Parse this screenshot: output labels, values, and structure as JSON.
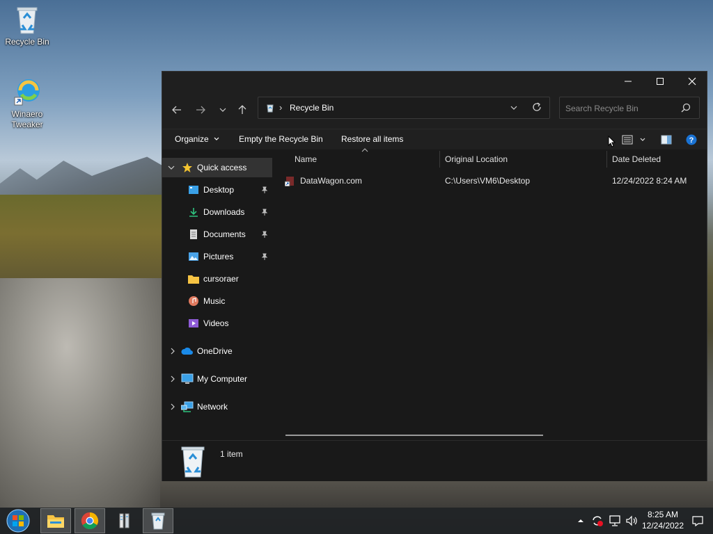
{
  "desktop": {
    "icons": [
      {
        "label": "Recycle Bin"
      },
      {
        "label": "Winaero\nTweaker",
        "line1": "Winaero",
        "line2": "Tweaker"
      }
    ]
  },
  "window": {
    "title": "Recycle Bin",
    "caption": {
      "minimize": "—",
      "maximize": "☐",
      "close": "✕"
    },
    "address": {
      "separator": "›",
      "location": "Recycle Bin"
    },
    "search": {
      "placeholder": "Search Recycle Bin"
    },
    "commands": {
      "organize": "Organize",
      "empty": "Empty the Recycle Bin",
      "restore": "Restore all items"
    },
    "nav": {
      "quick_access": "Quick access",
      "items": [
        {
          "label": "Desktop",
          "pinned": true,
          "icon": "desktop-icon"
        },
        {
          "label": "Downloads",
          "pinned": true,
          "icon": "download-icon"
        },
        {
          "label": "Documents",
          "pinned": true,
          "icon": "documents-icon"
        },
        {
          "label": "Pictures",
          "pinned": true,
          "icon": "pictures-icon"
        },
        {
          "label": "cursoraer",
          "pinned": false,
          "icon": "folder-icon"
        },
        {
          "label": "Music",
          "pinned": false,
          "icon": "music-icon"
        },
        {
          "label": "Videos",
          "pinned": false,
          "icon": "videos-icon"
        }
      ],
      "onedrive": "OneDrive",
      "my_computer": "My Computer",
      "network": "Network"
    },
    "columns": {
      "name": "Name",
      "original_location": "Original Location",
      "date_deleted": "Date Deleted"
    },
    "rows": [
      {
        "name": "DataWagon.com",
        "original_location": "C:\\Users\\VM6\\Desktop",
        "date_deleted": "12/24/2022 8:24 AM"
      }
    ],
    "details": {
      "count": "1 item"
    }
  },
  "taskbar": {
    "clock": {
      "time": "8:25 AM",
      "date": "12/24/2022"
    }
  },
  "colors": {
    "window_bg": "#191919",
    "accent": "#0078d4",
    "star": "#f4c430"
  }
}
